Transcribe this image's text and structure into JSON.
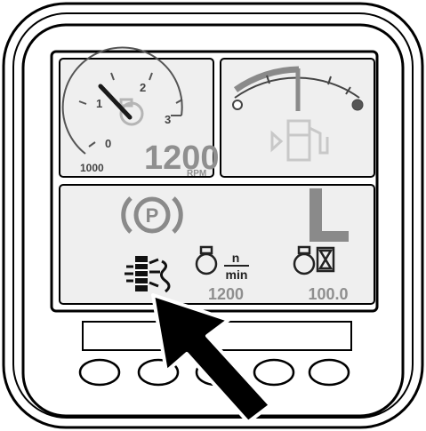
{
  "colors": {
    "bezel_outer": "#ffffff",
    "bezel_stroke": "#000000",
    "screen_bg": "#ffffff",
    "panel_bg": "#efefef",
    "gauge_gray": "#9a9a9a",
    "needle": "#1a1a1a",
    "fuel_arc_dark": "#8a8a8a",
    "fuel_icon": "#c8c8c8",
    "text_gray": "#8f8f8f",
    "arrow": "#000000"
  },
  "tachometer": {
    "tick_labels": [
      "0",
      "1",
      "2",
      "3"
    ],
    "scale_label": "1000",
    "rpm_value": "1200",
    "rpm_unit": "RPM",
    "needle_icon": "engine-icon"
  },
  "fuel_gauge": {
    "icon": "fuel-pump-icon",
    "empty_marker": "empty-circle-icon",
    "full_marker": "full-circle-icon"
  },
  "status_panel": {
    "parking_brake_icon": "parking-brake-icon",
    "parking_brake_letter": "P",
    "range_letter": "L",
    "regen_icon": "dpf-regeneration-icon",
    "engine_speed": {
      "icon": "engine-rpm-icon",
      "unit_top": "n",
      "unit_bottom": "min",
      "value": "1200"
    },
    "engine_hours": {
      "icon": "engine-hours-icon",
      "value": "100.0"
    }
  },
  "soft_keys": [
    "soft-key-1",
    "soft-key-2",
    "soft-key-3",
    "soft-key-4",
    "soft-key-5"
  ],
  "pointer_arrow": "pointer-arrow"
}
